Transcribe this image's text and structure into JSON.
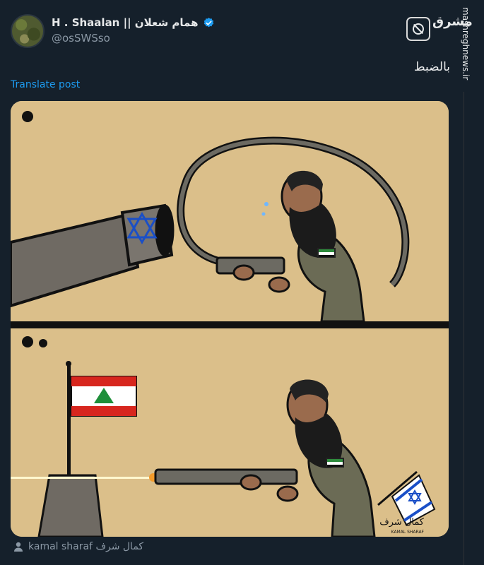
{
  "author": {
    "display_name": "H . Shaalan || همام شعلان",
    "handle": "@osSWSso"
  },
  "site": {
    "logo_text": "مشرق",
    "watermark": "mashreghnews.ir"
  },
  "post": {
    "text": "بالضبط",
    "translate_label": "Translate post"
  },
  "media": {
    "artist_signature": "كمال شرف",
    "artist_signature_latin": "KAMAL SHARAF"
  },
  "credit": {
    "label": "kamal  sharaf كمال شرف"
  },
  "colors": {
    "background": "#15202b",
    "panel": "#dbbf8a",
    "link": "#1d9bf0",
    "muted": "#8b98a5"
  }
}
